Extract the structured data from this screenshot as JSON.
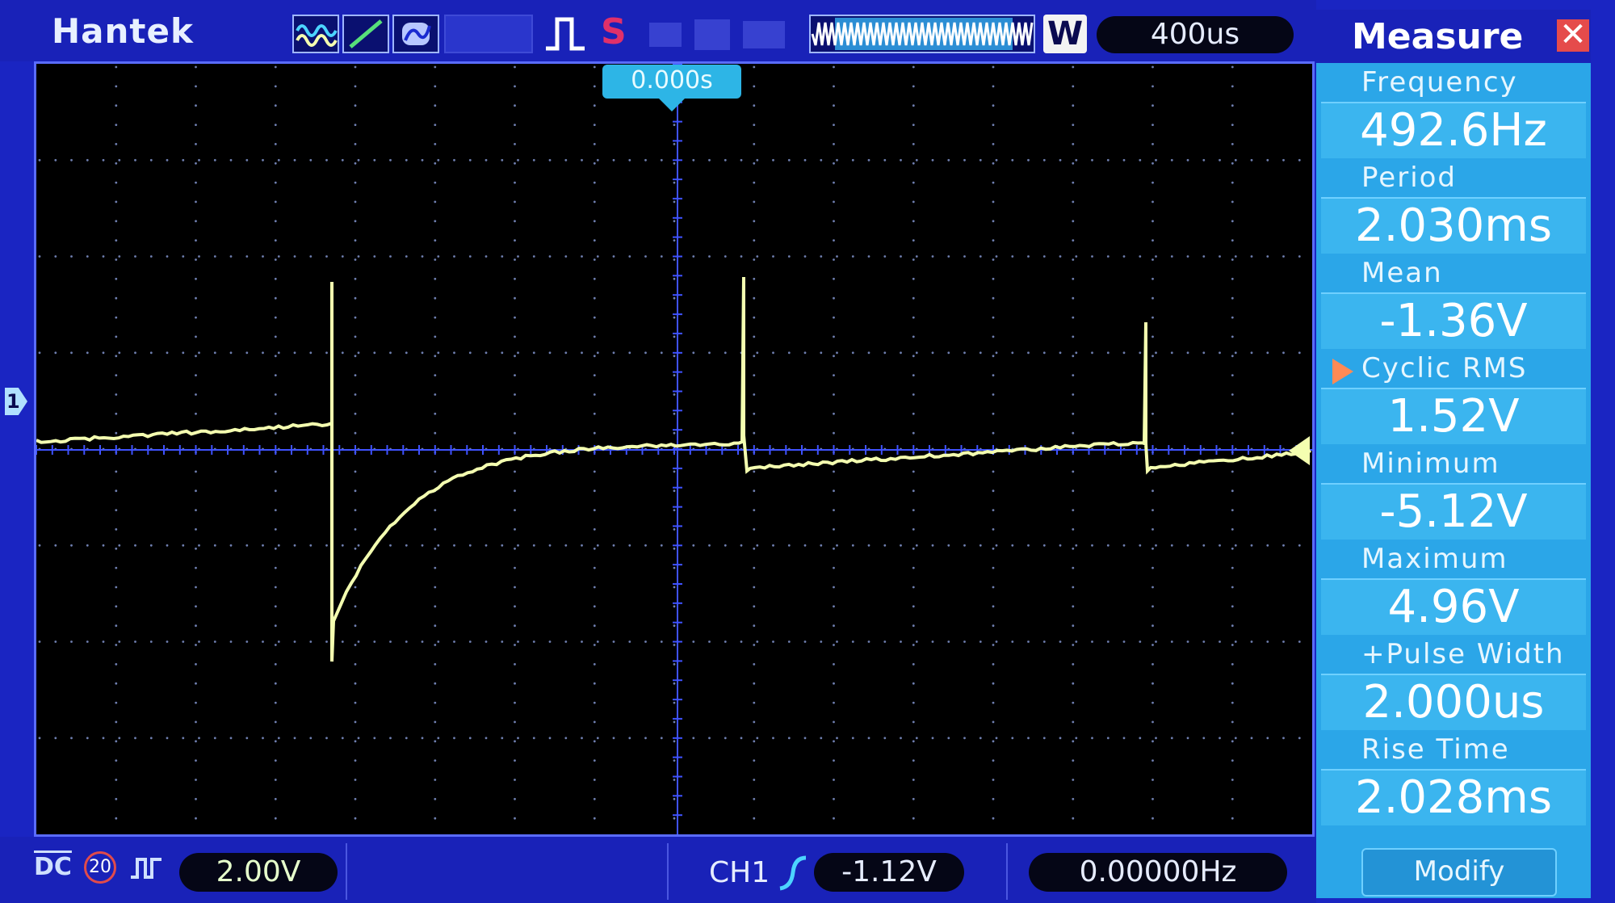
{
  "header": {
    "brand": "Hantek",
    "icons": [
      "waveform-icon",
      "slope-icon",
      "persistence-icon",
      "pulse-trigger-icon",
      "stop-icon",
      "memory-depth-icon",
      "w-mode-icon"
    ],
    "status_s": "S",
    "w_label": "W",
    "timebase": "400us"
  },
  "plot": {
    "trigger_time": "0.000s",
    "channel_marker": "1",
    "trace_color": "#f4ffb0",
    "grid_color": "#2f3fe0"
  },
  "measure": {
    "title": "Measure",
    "close_label": "✕",
    "items": [
      {
        "label": "Frequency",
        "value": "492.6Hz"
      },
      {
        "label": "Period",
        "value": "2.030ms"
      },
      {
        "label": "Mean",
        "value": "-1.36V"
      },
      {
        "label": "Cyclic RMS",
        "value": "1.52V"
      },
      {
        "label": "Minimum",
        "value": "-5.12V"
      },
      {
        "label": "Maximum",
        "value": "4.96V"
      },
      {
        "label": "+Pulse Width",
        "value": "2.000us"
      },
      {
        "label": "Rise Time",
        "value": "2.028ms"
      }
    ],
    "selected_item": "Cyclic RMS",
    "modify_label": "Modify"
  },
  "footer": {
    "coupling": "DC",
    "bandwidth_limit": "20",
    "volts_per_div": "2.00V",
    "trigger_channel": "CH1",
    "trigger_level": "-1.12V",
    "trigger_frequency": "0.00000Hz"
  },
  "colors": {
    "frame_blue": "#1922b8",
    "panel_cyan": "#2ba6e8",
    "close_red": "#e54b4b",
    "trace_yellow": "#f4ffb0"
  }
}
